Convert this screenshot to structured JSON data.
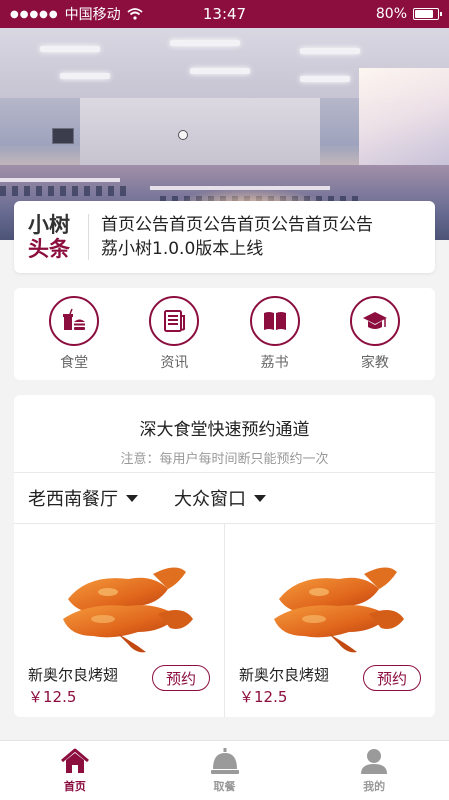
{
  "status_bar": {
    "carrier": "中国移动",
    "time": "13:47",
    "battery": "80%",
    "battery_level": 0.8
  },
  "headline": {
    "logo_line1": "小树",
    "logo_line2": "头条",
    "line1": "首页公告首页公告首页公告首页公告",
    "line2": "荔小树1.0.0版本上线"
  },
  "menu": {
    "items": [
      {
        "label": "食堂",
        "icon": "canteen-icon"
      },
      {
        "label": "资讯",
        "icon": "news-icon"
      },
      {
        "label": "荔书",
        "icon": "book-icon"
      },
      {
        "label": "家教",
        "icon": "graduation-cap-icon"
      }
    ]
  },
  "booking": {
    "title": "深大食堂快速预约通道",
    "note": "注意：每用户每时间断只能预约一次",
    "filters": [
      "老西南餐厅",
      "大众窗口"
    ],
    "products": [
      {
        "name": "新奥尔良烤翅",
        "price": "￥12.5",
        "button": "预约"
      },
      {
        "name": "新奥尔良烤翅",
        "price": "￥12.5",
        "button": "预约"
      }
    ]
  },
  "tabbar": {
    "tabs": [
      {
        "label": "首页",
        "icon": "home-icon",
        "active": true
      },
      {
        "label": "取餐",
        "icon": "cloche-icon",
        "active": false
      },
      {
        "label": "我的",
        "icon": "user-icon",
        "active": false
      }
    ]
  },
  "colors": {
    "primary": "#8b0e3f",
    "background": "#f3f3f3"
  }
}
